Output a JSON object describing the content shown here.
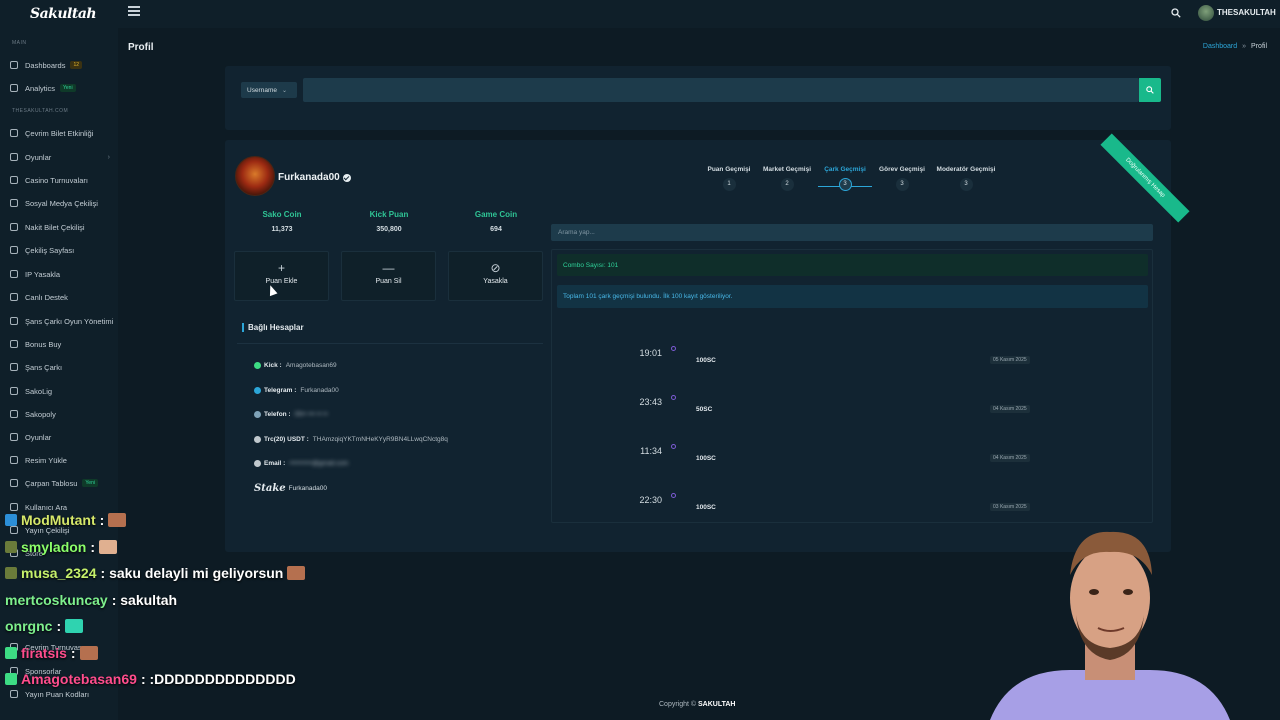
{
  "app": {
    "logo_text": "Sakultah",
    "user_name": "THESAKULTAH"
  },
  "sidebar": {
    "sections": [
      "MAIN",
      "THESAKULTAH.COM"
    ],
    "items": [
      {
        "label": "Dashboards",
        "badge": "12",
        "badge_color": "#e2b42b"
      },
      {
        "label": "Analytics",
        "badge": "Yeni",
        "badge_color": "#2fd39a"
      },
      {
        "label": "Çevrim Bilet Etkinliği"
      },
      {
        "label": "Oyunlar",
        "chevron": "›"
      },
      {
        "label": "Casino Turnuvaları"
      },
      {
        "label": "Sosyal Medya Çekilişi"
      },
      {
        "label": "Nakit Bilet Çekilişi"
      },
      {
        "label": "Çekiliş Sayfası"
      },
      {
        "label": "IP Yasakla"
      },
      {
        "label": "Canlı Destek"
      },
      {
        "label": "Şans Çarkı Oyun Yönetimi"
      },
      {
        "label": "Bonus Buy"
      },
      {
        "label": "Şans Çarkı"
      },
      {
        "label": "SakoLig"
      },
      {
        "label": "Sakopoly"
      },
      {
        "label": "Oyunlar"
      },
      {
        "label": "Resim Yükle"
      },
      {
        "label": "Çarpan Tablosu",
        "badge": "Yeni",
        "badge_color": "#2fd39a"
      },
      {
        "label": "Kullanıcı Ara"
      },
      {
        "label": "Yayın Çekilişi"
      },
      {
        "label": "Store"
      },
      {
        "label": "Çevrim Turnuvası"
      },
      {
        "label": "Sponsorlar"
      },
      {
        "label": "Yayın Puan Kodları"
      }
    ]
  },
  "page": {
    "title": "Profil",
    "breadcrumb": {
      "link": "Dashboard",
      "sep": "»",
      "current": "Profil"
    }
  },
  "search": {
    "select_label": "Username",
    "select_caret": "⌄",
    "value": ""
  },
  "profile": {
    "username": "Furkanada00",
    "ribbon": "Doğrulanmış Hesap",
    "stats": [
      {
        "label": "Sako Coin",
        "value": "11,373"
      },
      {
        "label": "Kick Puan",
        "value": "350,800"
      },
      {
        "label": "Game Coin",
        "value": "694"
      }
    ],
    "actions": [
      {
        "symbol": "+",
        "label": "Puan Ekle"
      },
      {
        "symbol": "—",
        "label": "Puan Sil"
      },
      {
        "symbol": "⊘",
        "label": "Yasakla"
      }
    ],
    "linked_title": "Bağlı Hesaplar",
    "linked": [
      {
        "key": "Kick :",
        "value": "Amagotebasan69",
        "color": "#3ddc84"
      },
      {
        "key": "Telegram :",
        "value": "Furkanada00",
        "color": "#2ca6d8"
      },
      {
        "key": "Telefon :",
        "value": "05•• ••• •• ••",
        "color": "#7fa3b8",
        "blurred": true
      },
      {
        "key": "Trc(20) USDT :",
        "value": "THAmzqiqYKTmNHeKYyR9BN4LLwqCNctg8q",
        "color": "#c0c8cd"
      },
      {
        "key": "Email :",
        "value": "••••••••••@gmail.com",
        "color": "#c0c8cd",
        "blurred": true
      },
      {
        "key": "Stake",
        "value": "Furkanada00"
      }
    ]
  },
  "tabs": [
    {
      "label": "Puan Geçmişi",
      "count": "1"
    },
    {
      "label": "Market Geçmişi",
      "count": "2"
    },
    {
      "label": "Çark Geçmişi",
      "count": "3",
      "active": true
    },
    {
      "label": "Görev Geçmişi",
      "count": "3"
    },
    {
      "label": "Moderatör Geçmişi",
      "count": "3"
    }
  ],
  "history": {
    "placeholder": "Arama yap...",
    "combo_text": "Combo Sayısı: 101",
    "info_text": "Toplam 101 çark geçmişi bulundu. İlk 100 kayıt gösteriliyor.",
    "entries": [
      {
        "time": "19:01",
        "amount": "100SC",
        "date": "05 Kasım 2025"
      },
      {
        "time": "23:43",
        "amount": "50SC",
        "date": "04 Kasım 2025"
      },
      {
        "time": "11:34",
        "amount": "100SC",
        "date": "04 Kasım 2025"
      },
      {
        "time": "22:30",
        "amount": "100SC",
        "date": "03 Kasım 2025"
      }
    ]
  },
  "chat": [
    {
      "user": "ModMutant",
      "text": ":",
      "color": "#d6e86a"
    },
    {
      "user": "smyladon",
      "text": ":",
      "color": "#8bff6a"
    },
    {
      "user": "musa_2324",
      "text": ": saku delayli mi geliyorsun",
      "color": "#c5f06b"
    },
    {
      "user": "mertcoskuncay",
      "text": ": sakultah",
      "color": "#7ef08d"
    },
    {
      "user": "onrgnc",
      "text": ":",
      "color": "#7ef08d"
    },
    {
      "user": "firatsis",
      "text": ":",
      "color": "#ff4d8d"
    },
    {
      "user": "Amagotebasan69",
      "text": ": :DDDDDDDDDDDDDD",
      "color": "#ff4d8d"
    }
  ],
  "footer": {
    "prefix": "Copyright ©",
    "brand": "SAKULTAH"
  }
}
